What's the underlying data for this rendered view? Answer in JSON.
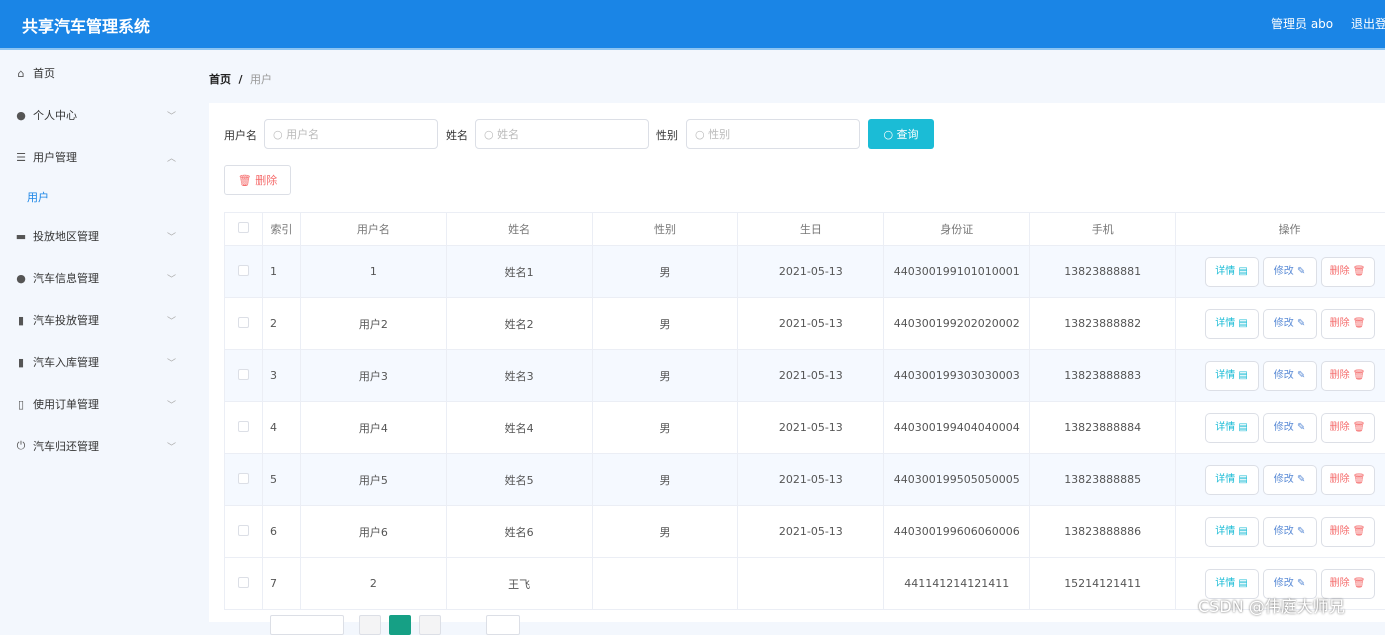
{
  "header": {
    "title": "共享汽车管理系统",
    "user": "管理员 abo",
    "logout": "退出登录"
  },
  "sidebar": {
    "items": [
      {
        "label": "首页",
        "icon": "home-icon",
        "glyph": "⌂"
      },
      {
        "label": "个人中心",
        "icon": "user-icon",
        "glyph": "●"
      },
      {
        "label": "用户管理",
        "icon": "list-icon",
        "glyph": "☰"
      },
      {
        "label": "投放地区管理",
        "icon": "monitor-icon",
        "glyph": "▬"
      },
      {
        "label": "汽车信息管理",
        "icon": "location-icon",
        "glyph": "●"
      },
      {
        "label": "汽车投放管理",
        "icon": "chart-icon",
        "glyph": "▮"
      },
      {
        "label": "汽车入库管理",
        "icon": "clipboard-icon",
        "glyph": "▮"
      },
      {
        "label": "使用订单管理",
        "icon": "phone-icon",
        "glyph": "▯"
      },
      {
        "label": "汽车归还管理",
        "icon": "power-icon",
        "glyph": "⏻"
      }
    ],
    "sub_item": "用户"
  },
  "breadcrumb": {
    "home": "首页",
    "sep": "/",
    "current": "用户"
  },
  "search": {
    "username_label": "用户名",
    "username_placeholder": "用户名",
    "name_label": "姓名",
    "name_placeholder": "姓名",
    "gender_label": "性别",
    "gender_placeholder": "性别",
    "query": "查询"
  },
  "delete_label": "删除",
  "table": {
    "headers": [
      "索引",
      "用户名",
      "姓名",
      "性别",
      "生日",
      "身份证",
      "手机",
      "操作"
    ],
    "rows": [
      [
        "1",
        "1",
        "姓名1",
        "男",
        "2021-05-13",
        "440300199101010001",
        "13823888881"
      ],
      [
        "2",
        "用户2",
        "姓名2",
        "男",
        "2021-05-13",
        "440300199202020002",
        "13823888882"
      ],
      [
        "3",
        "用户3",
        "姓名3",
        "男",
        "2021-05-13",
        "440300199303030003",
        "13823888883"
      ],
      [
        "4",
        "用户4",
        "姓名4",
        "男",
        "2021-05-13",
        "440300199404040004",
        "13823888884"
      ],
      [
        "5",
        "用户5",
        "姓名5",
        "男",
        "2021-05-13",
        "440300199505050005",
        "13823888885"
      ],
      [
        "6",
        "用户6",
        "姓名6",
        "男",
        "2021-05-13",
        "440300199606060006",
        "13823888886"
      ],
      [
        "7",
        "2",
        "王飞",
        "",
        "",
        "441141214121411",
        "15214121411"
      ]
    ],
    "actions": {
      "detail": "详情",
      "edit": "修改",
      "delete": "删除"
    }
  },
  "watermark": "CSDN @伟庭大师兄"
}
